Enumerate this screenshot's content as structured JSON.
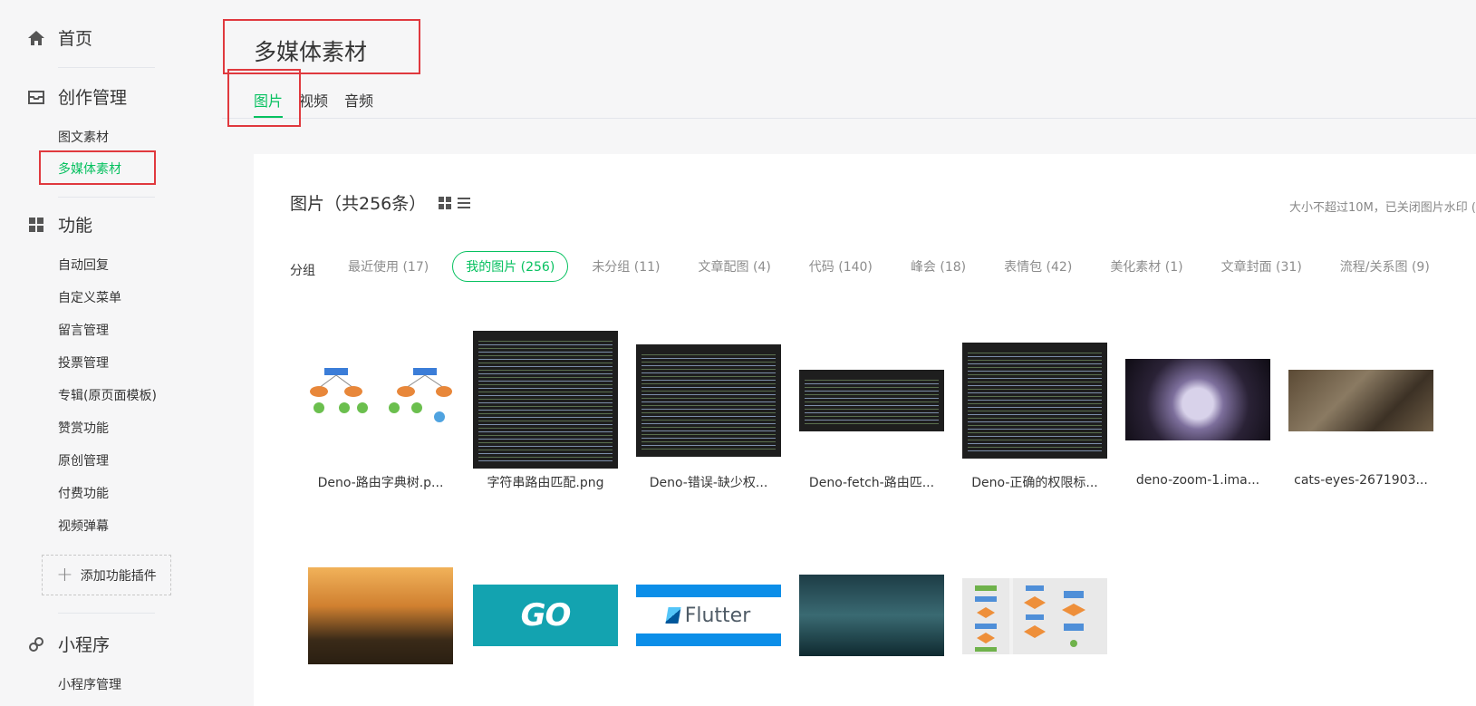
{
  "sidebar": {
    "home": "首页",
    "creation": "创作管理",
    "creation_items": [
      "图文素材",
      "多媒体素材"
    ],
    "features": "功能",
    "feature_items": [
      "自动回复",
      "自定义菜单",
      "留言管理",
      "投票管理",
      "专辑(原页面模板)",
      "赞赏功能",
      "原创管理",
      "付费功能",
      "视频弹幕"
    ],
    "add_plugin": "添加功能插件",
    "miniprogram": "小程序",
    "miniprogram_items": [
      "小程序管理"
    ]
  },
  "header": {
    "title": "多媒体素材",
    "tabs": [
      "图片",
      "视频",
      "音频"
    ]
  },
  "panel": {
    "title": "图片（共256条）",
    "hint": "大小不超过10M，已关闭图片水印 (",
    "group_label": "分组",
    "groups": [
      "最近使用 (17)",
      "我的图片 (256)",
      "未分组 (11)",
      "文章配图 (4)",
      "代码 (140)",
      "峰会 (18)",
      "表情包 (42)",
      "美化素材 (1)",
      "文章封面 (31)",
      "流程/关系图 (9)"
    ],
    "images_row1": [
      "Deno-路由字典树.p...",
      "字符串路由匹配.png",
      "Deno-错误-缺少权...",
      "Deno-fetch-路由匹...",
      "Deno-正确的权限标...",
      "deno-zoom-1.ima...",
      "cats-eyes-2671903..."
    ],
    "go_logo": "GO",
    "flutter_logo": "Flutter"
  },
  "colors": {
    "accent": "#07c160",
    "highlight": "#e0393e"
  }
}
